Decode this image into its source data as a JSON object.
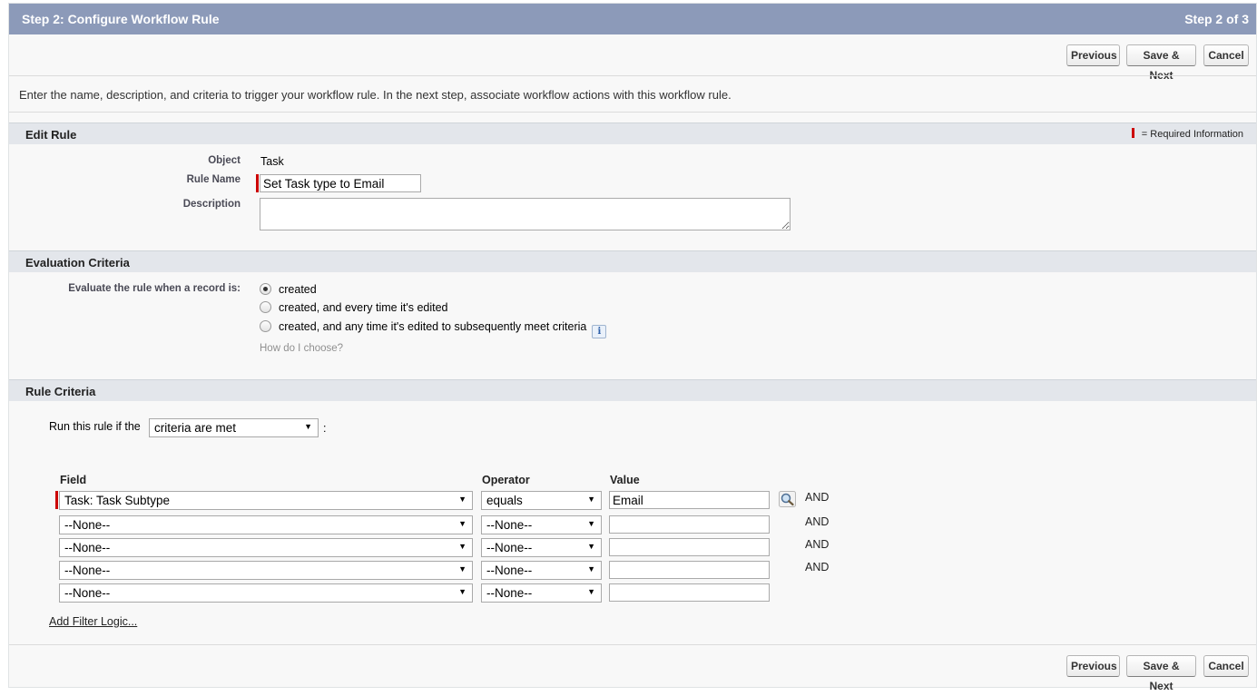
{
  "header": {
    "title": "Step 2: Configure Workflow Rule",
    "step": "Step 2 of 3"
  },
  "buttons": {
    "previous": "Previous",
    "save_next": "Save & Next",
    "cancel": "Cancel"
  },
  "intro": "Enter the name, description, and criteria to trigger your workflow rule. In the next step, associate workflow actions with this workflow rule.",
  "edit_rule": {
    "heading": "Edit Rule",
    "required_legend": "= Required Information",
    "object_label": "Object",
    "object_value": "Task",
    "rule_name_label": "Rule Name",
    "rule_name_value": "Set Task type to Email",
    "description_label": "Description",
    "description_value": ""
  },
  "evaluation": {
    "heading": "Evaluation Criteria",
    "label": "Evaluate the rule when a record is:",
    "options": [
      {
        "label": "created",
        "checked": true
      },
      {
        "label": "created, and every time it's edited",
        "checked": false
      },
      {
        "label": "created, and any time it's edited to subsequently meet criteria",
        "checked": false
      }
    ],
    "info_icon": "info-icon",
    "help_link": "How do I choose?"
  },
  "rule_criteria": {
    "heading": "Rule Criteria",
    "run_prefix": "Run this rule if the",
    "run_select": "criteria are met",
    "run_suffix": ":",
    "columns": {
      "field": "Field",
      "operator": "Operator",
      "value": "Value"
    },
    "rows": [
      {
        "field": "Task: Task Subtype",
        "operator": "equals",
        "value": "Email",
        "conj": "AND"
      },
      {
        "field": "--None--",
        "operator": "--None--",
        "value": "",
        "conj": "AND"
      },
      {
        "field": "--None--",
        "operator": "--None--",
        "value": "",
        "conj": "AND"
      },
      {
        "field": "--None--",
        "operator": "--None--",
        "value": "",
        "conj": "AND"
      },
      {
        "field": "--None--",
        "operator": "--None--",
        "value": "",
        "conj": ""
      }
    ],
    "filter_logic_link": "Add Filter Logic..."
  },
  "colors": {
    "header_bg": "#8c9ab9",
    "section_bg": "#e3e6eb",
    "required": "#cc0000"
  }
}
